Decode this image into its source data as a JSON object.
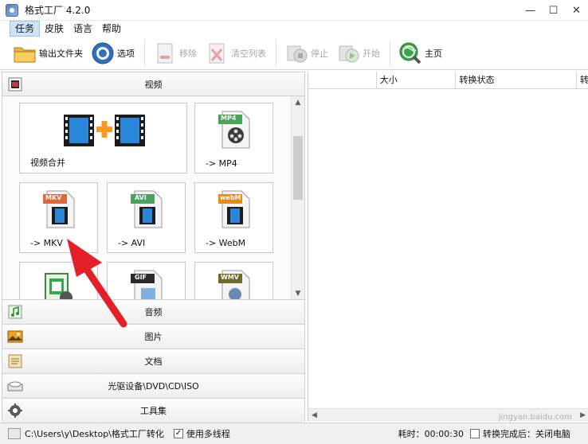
{
  "window": {
    "title": "格式工厂 4.2.0",
    "controls": {
      "minimize": "—",
      "maximize": "☐",
      "close": "✕"
    }
  },
  "menu": [
    "任务",
    "皮肤",
    "语言",
    "帮助"
  ],
  "toolbar": {
    "output_folder": "输出文件夹",
    "options": "选项",
    "remove": "移除",
    "clear_list": "清空列表",
    "stop": "停止",
    "start": "开始",
    "home": "主页"
  },
  "categories": {
    "video": "视频",
    "audio": "音频",
    "image": "图片",
    "document": "文档",
    "optical": "光驱设备\\DVD\\CD\\ISO",
    "tools": "工具集"
  },
  "tiles": {
    "merge": "视频合并",
    "mp4": "-> MP4",
    "mkv": "-> MKV",
    "avi": "-> AVI",
    "webm": "-> WebM",
    "badge_mp4": "MP4",
    "badge_mkv": "MKV",
    "badge_avi": "AVI",
    "badge_webm": "webM",
    "badge_gif": "GIF",
    "badge_wmv": "WMV"
  },
  "list": {
    "columns": [
      "",
      "大小",
      "转换状态",
      "转"
    ]
  },
  "status": {
    "path": "C:\\Users\\y\\Desktop\\格式工厂转化",
    "multithread_label": "使用多线程",
    "multithread_checked": "✓",
    "elapsed": "耗时：00:00:30",
    "after_done": "转换完成后：关闭电脑"
  },
  "watermark": "jingyan.baidu.com",
  "colors": {
    "accent": "#cfe3f6",
    "arrow": "#e3202a",
    "film": "#1b6fbf"
  }
}
